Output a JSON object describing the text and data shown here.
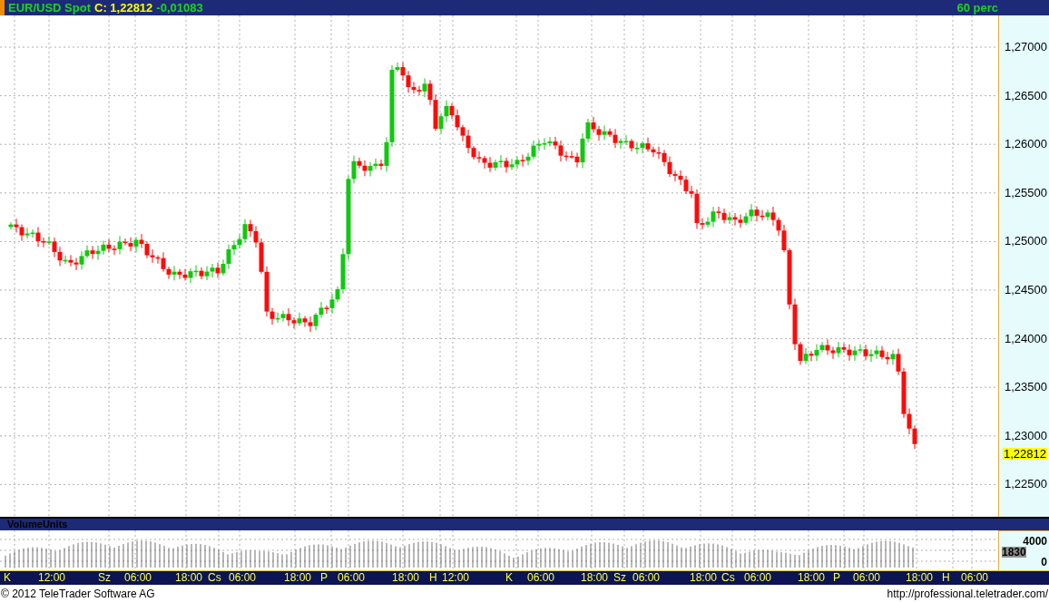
{
  "header": {
    "instrument": "EUR/USD Spot",
    "close": "C: 1,22812",
    "change": "-0,01083",
    "interval": "60 perc"
  },
  "price_axis": {
    "labels": [
      "1,27000",
      "1,26500",
      "1,26000",
      "1,25500",
      "1,25000",
      "1,24500",
      "1,24000",
      "1,23500",
      "1,23000",
      "1,22500"
    ],
    "current": "1,22812"
  },
  "volume_panel": {
    "title": "VolumeUnits",
    "axis_labels": [
      "4000",
      "0"
    ],
    "current": "1830"
  },
  "time_axis": {
    "labels": [
      "K",
      "12:00",
      "Sz",
      "06:00",
      "18:00",
      "Cs",
      "06:00",
      "18:00",
      "P",
      "06:00",
      "18:00",
      "H",
      "12:00",
      "K",
      "06:00",
      "18:00",
      "Sz",
      "06:00",
      "18:00",
      "Cs",
      "06:00",
      "18:00",
      "P",
      "06:00",
      "18:00",
      "H",
      "06:00"
    ]
  },
  "footer": {
    "copyright": "© 2012 TeleTrader Software AG",
    "url": "http://professional.teletrader.com/"
  }
}
